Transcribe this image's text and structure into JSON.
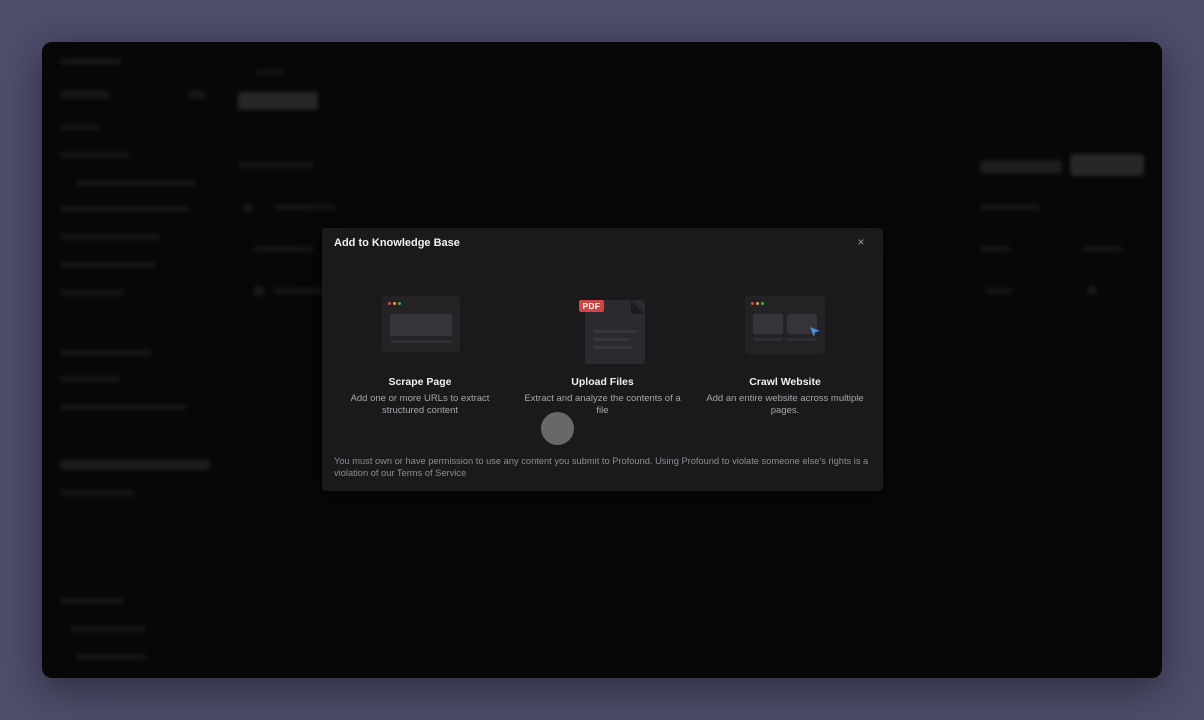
{
  "modal": {
    "title": "Add to Knowledge Base",
    "close_label": "×",
    "options": [
      {
        "title": "Scrape Page",
        "description": "Add one or more URLs to extract structured content",
        "icon": "browser-window-icon"
      },
      {
        "title": "Upload Files",
        "description": "Extract and analyze the contents of a file",
        "icon": "pdf-document-icon",
        "badge": "PDF"
      },
      {
        "title": "Crawl Website",
        "description": "Add an entire website across multiple pages.",
        "icon": "crawl-cursor-icon"
      }
    ],
    "disclaimer": {
      "text_before": "You must own or have permission to use any content you submit to Profound. Using Profound to violate someone else's rights is a violation of our ",
      "link": "Terms of Service"
    }
  },
  "colors": {
    "backdrop": "#4d4d6c",
    "window": "#0a0a0b",
    "modal": "#1a1a1c",
    "pdf_badge": "#d24545",
    "cursor_accent": "#4a90e2",
    "dot_red": "#e0443e",
    "dot_yellow": "#d9a83b",
    "dot_green": "#3fae4f"
  }
}
